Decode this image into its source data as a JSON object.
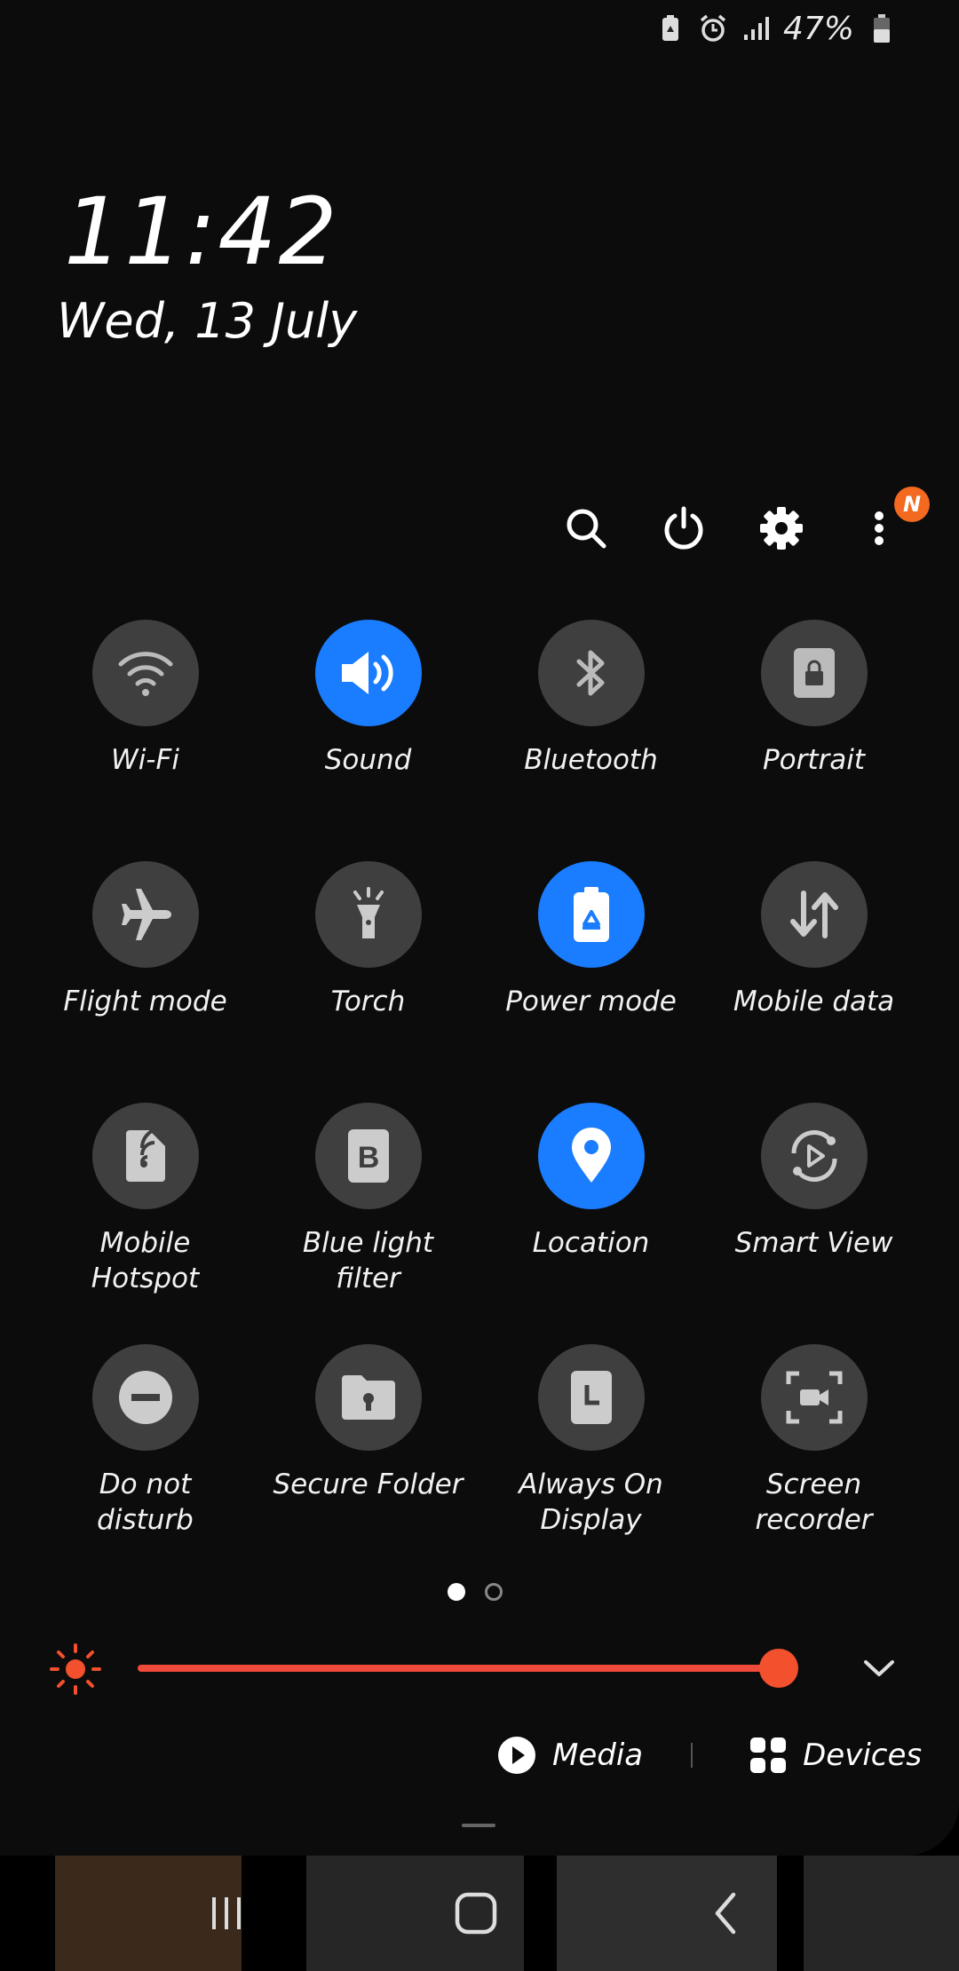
{
  "status_bar": {
    "battery_percent": "47%",
    "icons": [
      "power-saving-icon",
      "alarm-icon",
      "signal-icon",
      "battery-icon"
    ]
  },
  "clock": {
    "time": "11:42",
    "date": "Wed, 13 July"
  },
  "toolbar": {
    "icons": [
      "search-icon",
      "power-icon",
      "settings-icon",
      "more-options-icon"
    ],
    "notification_badge": "N"
  },
  "tiles": [
    {
      "label": "Wi-Fi",
      "icon": "wifi-icon",
      "on": false
    },
    {
      "label": "Sound",
      "icon": "sound-icon",
      "on": true
    },
    {
      "label": "Bluetooth",
      "icon": "bluetooth-icon",
      "on": false
    },
    {
      "label": "Portrait",
      "icon": "portrait-lock-icon",
      "on": false
    },
    {
      "label": "Flight mode",
      "icon": "airplane-icon",
      "on": false
    },
    {
      "label": "Torch",
      "icon": "torch-icon",
      "on": false
    },
    {
      "label": "Power mode",
      "icon": "power-mode-icon",
      "on": true
    },
    {
      "label": "Mobile data",
      "icon": "mobile-data-icon",
      "on": false
    },
    {
      "label": "Mobile Hotspot",
      "icon": "hotspot-icon",
      "on": false
    },
    {
      "label": "Blue light filter",
      "icon": "blue-light-filter-icon",
      "on": false
    },
    {
      "label": "Location",
      "icon": "location-icon",
      "on": true
    },
    {
      "label": "Smart View",
      "icon": "smart-view-icon",
      "on": false
    },
    {
      "label": "Do not disturb",
      "icon": "do-not-disturb-icon",
      "on": false
    },
    {
      "label": "Secure Folder",
      "icon": "secure-folder-icon",
      "on": false
    },
    {
      "label": "Always On Display",
      "icon": "always-on-display-icon",
      "on": false
    },
    {
      "label": "Screen recorder",
      "icon": "screen-recorder-icon",
      "on": false
    }
  ],
  "pager": {
    "current_page": 1,
    "total_pages": 2
  },
  "brightness": {
    "level": 0.97,
    "accent": "#f3502e"
  },
  "actions": {
    "media_label": "Media",
    "devices_label": "Devices"
  },
  "colors": {
    "tile_on": "#1a7cff",
    "tile_off": "#3f3f3f",
    "badge": "#f3691f"
  }
}
